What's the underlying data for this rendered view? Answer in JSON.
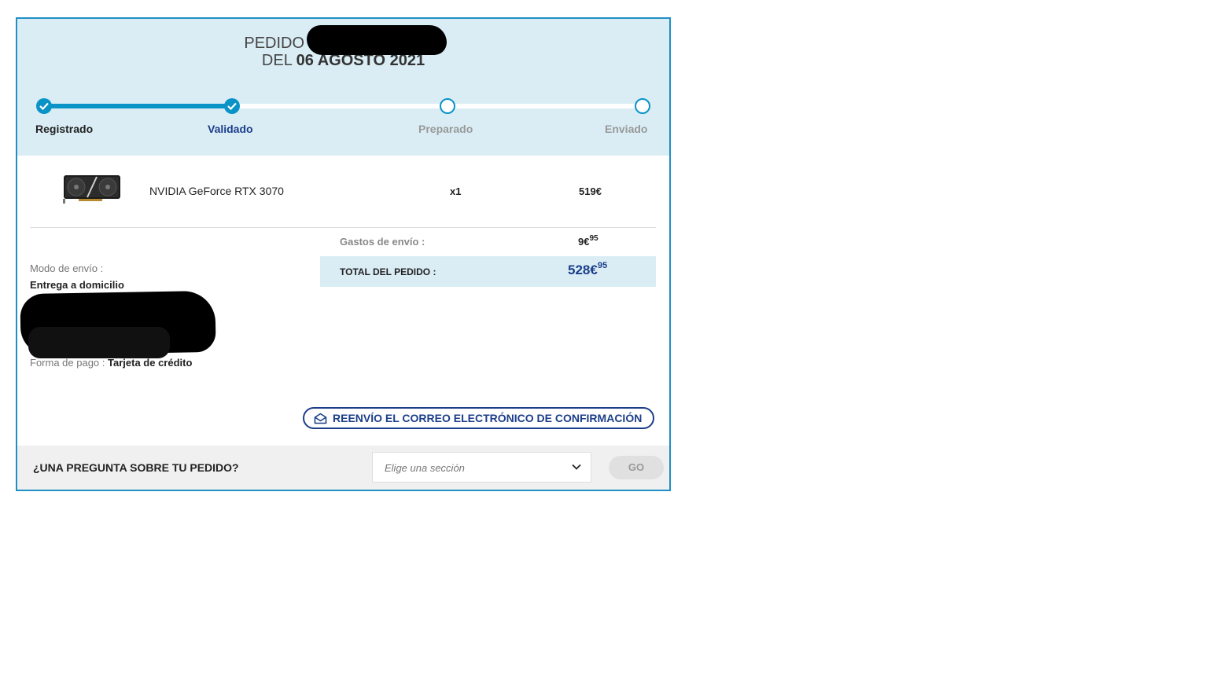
{
  "order": {
    "title_prefix": "PEDIDO",
    "date_prefix": "DEL",
    "date": "06 AGOSTO 2021"
  },
  "progress": {
    "completed_fraction": 0.31,
    "steps": [
      {
        "label": "Registrado",
        "state": "done"
      },
      {
        "label": "Validado",
        "state": "done"
      },
      {
        "label": "Preparado",
        "state": "pending"
      },
      {
        "label": "Enviado",
        "state": "pending"
      }
    ]
  },
  "item": {
    "name": "NVIDIA GeForce RTX 3070",
    "quantity": "x1",
    "price": "519€"
  },
  "summary": {
    "shipping_label": "Gastos de envío :",
    "shipping_int": "9€",
    "shipping_cents": "95",
    "total_label": "TOTAL DEL PEDIDO :",
    "total_int": "528€",
    "total_cents": "95"
  },
  "delivery": {
    "mode_label": "Modo de envío :",
    "mode_value": "Entrega a domicilio",
    "payment_label": "Forma de pago :",
    "payment_value": "Tarjeta de crédito"
  },
  "actions": {
    "resend_label": "REENVÍO EL CORREO ELECTRÓNICO DE CONFIRMACIÓN"
  },
  "footer": {
    "question": "¿UNA PREGUNTA SOBRE TU PEDIDO?",
    "select_placeholder": "Elige una sección",
    "go_label": "GO"
  },
  "colors": {
    "accent": "#0a93c7",
    "header_bg": "#daedf5",
    "link_blue": "#1c3e8a",
    "step_done_text": "#222222",
    "step_active_text": "#1c3e8a",
    "step_pending_text": "#999999"
  }
}
